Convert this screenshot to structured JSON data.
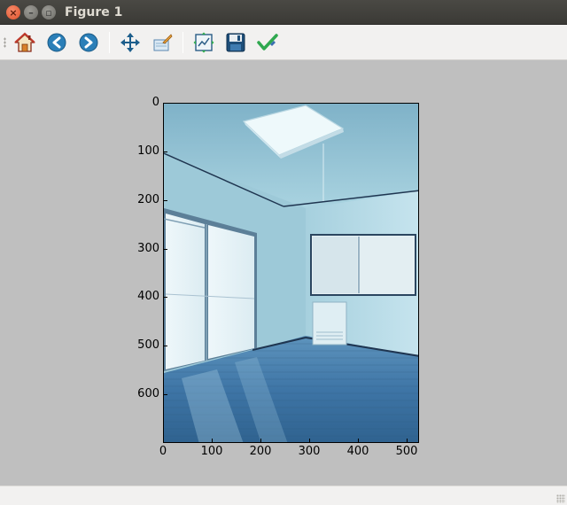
{
  "window": {
    "title": "Figure 1"
  },
  "toolbar": {
    "buttons": [
      {
        "icon": "home-icon",
        "tooltip": "Home"
      },
      {
        "icon": "back-arrow-icon",
        "tooltip": "Back"
      },
      {
        "icon": "forward-arrow-icon",
        "tooltip": "Forward"
      },
      {
        "icon": "pan-icon",
        "tooltip": "Pan"
      },
      {
        "icon": "zoom-rect-icon",
        "tooltip": "Zoom"
      },
      {
        "icon": "subplots-icon",
        "tooltip": "Configure subplots"
      },
      {
        "icon": "save-icon",
        "tooltip": "Save"
      },
      {
        "icon": "edit-check-icon",
        "tooltip": "Edit axis"
      }
    ]
  },
  "plot": {
    "content": "photo of empty room with blue wooden floor, window with frosted glass on left, ceiling light, small window on right wall, wall heater",
    "y_ticks": [
      "0",
      "100",
      "200",
      "300",
      "400",
      "500",
      "600"
    ],
    "x_ticks": [
      "0",
      "100",
      "200",
      "300",
      "400",
      "500"
    ],
    "image_extent": {
      "x": [
        0,
        525
      ],
      "y": [
        700,
        0
      ]
    }
  },
  "colors": {
    "figure_bg": "#bfbfbf",
    "toolbar_bg": "#f2f1f0",
    "titlebar_bg": "#3c3b37"
  }
}
